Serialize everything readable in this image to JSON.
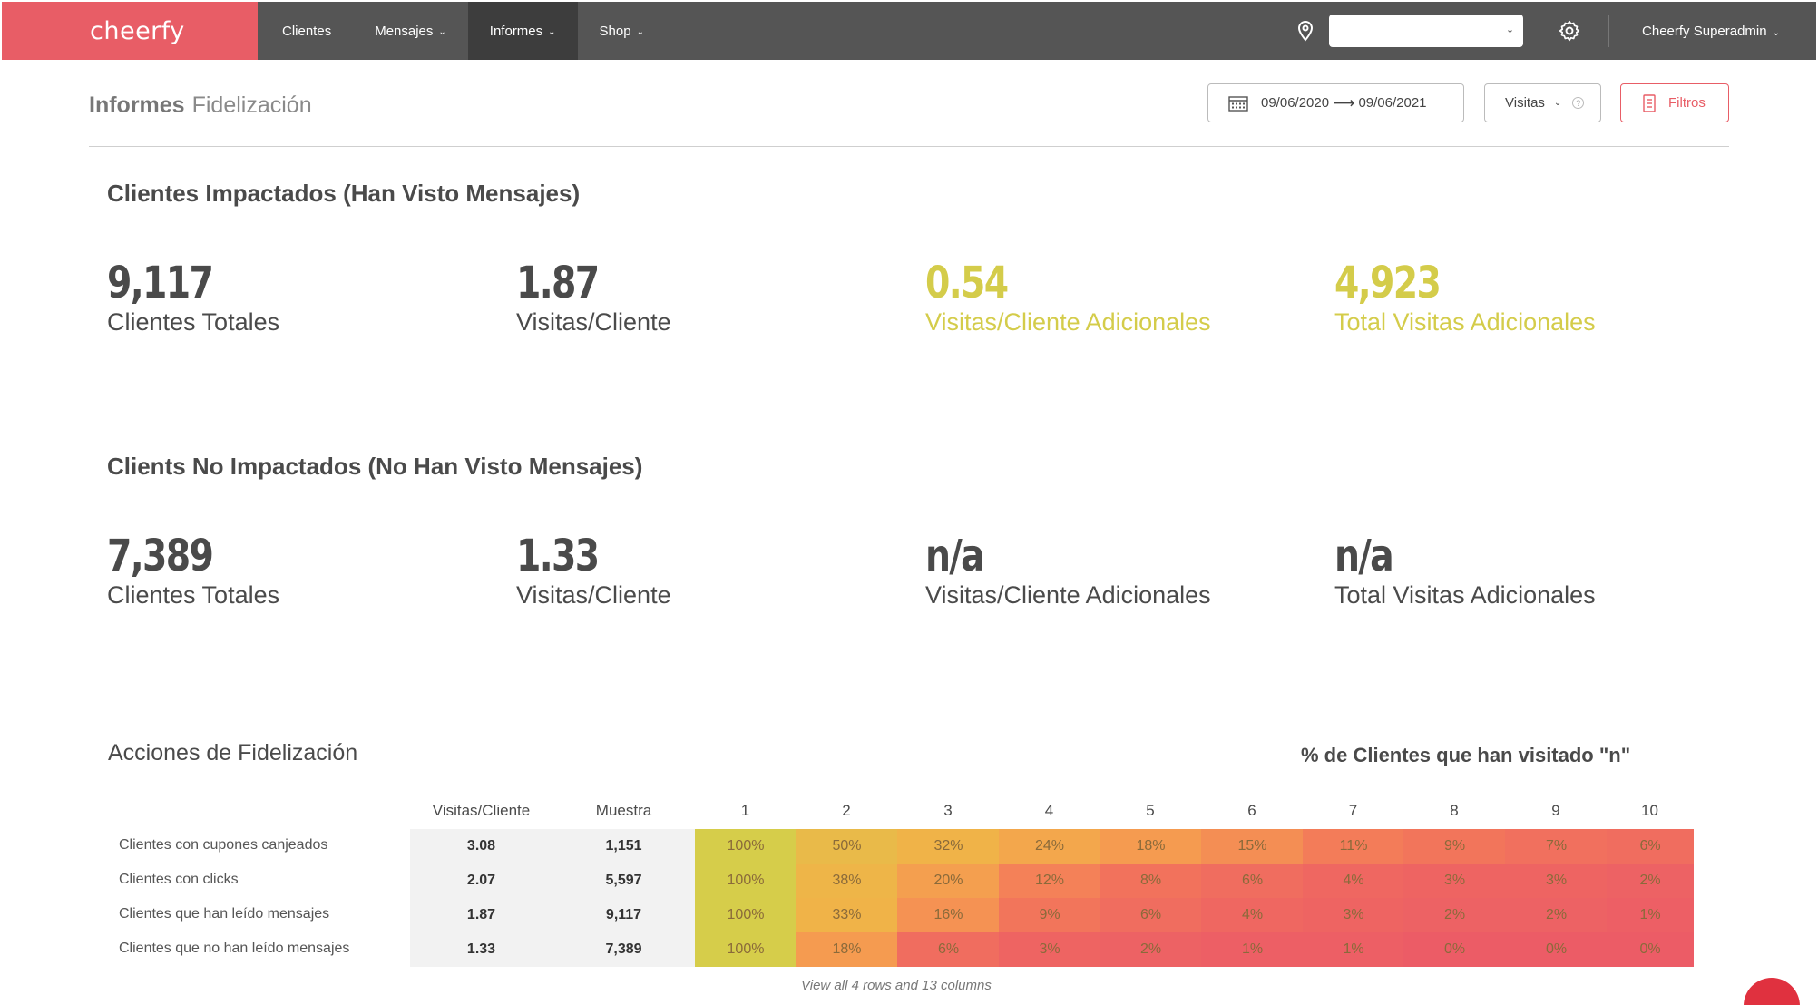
{
  "brand": "cheerfy",
  "nav": [
    {
      "label": "Clientes",
      "chevron": false,
      "active": false
    },
    {
      "label": "Mensajes",
      "chevron": true,
      "active": false
    },
    {
      "label": "Informes",
      "chevron": true,
      "active": true
    },
    {
      "label": "Shop",
      "chevron": true,
      "active": false
    }
  ],
  "location_select": {
    "value": ""
  },
  "user": {
    "label": "Cheerfy Superadmin"
  },
  "breadcrumb": {
    "section": "Informes",
    "page": "Fidelización"
  },
  "date_range": {
    "start": "09/06/2020",
    "arrow": "⟶",
    "end": "09/06/2021"
  },
  "metric_select": {
    "value": "Visitas",
    "help": "?"
  },
  "filters_button": "Filtros",
  "impacted": {
    "title": "Clientes Impactados (Han Visto Mensajes)",
    "kpis": [
      {
        "value": "9,117",
        "label": "Clientes Totales"
      },
      {
        "value": "1.87",
        "label": "Visitas/Cliente"
      },
      {
        "value": "0.54",
        "label": "Visitas/Cliente Adicionales"
      },
      {
        "value": "4,923",
        "label": "Total Visitas Adicionales"
      }
    ]
  },
  "not_impacted": {
    "title": "Clients No Impactados (No Han Visto Mensajes)",
    "kpis": [
      {
        "value": "7,389",
        "label": "Clientes Totales"
      },
      {
        "value": "1.33",
        "label": "Visitas/Cliente"
      },
      {
        "value": "n/a",
        "label": "Visitas/Cliente Adicionales"
      },
      {
        "value": "n/a",
        "label": "Total Visitas Adicionales"
      }
    ]
  },
  "actions": {
    "title": "Acciones de Fidelización",
    "pct_title": "% de Clientes que han visitado \"n\"",
    "headers": [
      "Visitas/Cliente",
      "Muestra",
      "1",
      "2",
      "3",
      "4",
      "5",
      "6",
      "7",
      "8",
      "9",
      "10"
    ],
    "rows": [
      {
        "label": "Clientes con cupones canjeados",
        "visits": "3.08",
        "sample": "1,151",
        "pcts": [
          "100%",
          "50%",
          "32%",
          "24%",
          "18%",
          "15%",
          "11%",
          "9%",
          "7%",
          "6%"
        ]
      },
      {
        "label": "Clientes con clicks",
        "visits": "2.07",
        "sample": "5,597",
        "pcts": [
          "100%",
          "38%",
          "20%",
          "12%",
          "8%",
          "6%",
          "4%",
          "3%",
          "3%",
          "2%"
        ]
      },
      {
        "label": "Clientes que han leído mensajes",
        "visits": "1.87",
        "sample": "9,117",
        "pcts": [
          "100%",
          "33%",
          "16%",
          "9%",
          "6%",
          "4%",
          "3%",
          "2%",
          "2%",
          "1%"
        ]
      },
      {
        "label": "Clientes que no han leído mensajes",
        "visits": "1.33",
        "sample": "7,389",
        "pcts": [
          "100%",
          "18%",
          "6%",
          "3%",
          "2%",
          "1%",
          "1%",
          "0%",
          "0%",
          "0%"
        ]
      }
    ],
    "footer": "View all 4 rows and 13 columns"
  },
  "colors": {
    "brand": "#e85d66",
    "topbar": "#555555",
    "highlight": "#d4cc4a",
    "heat_high": "#d6cd4a",
    "heat_mid": "#f5a04a",
    "heat_low": "#ef5b66"
  }
}
